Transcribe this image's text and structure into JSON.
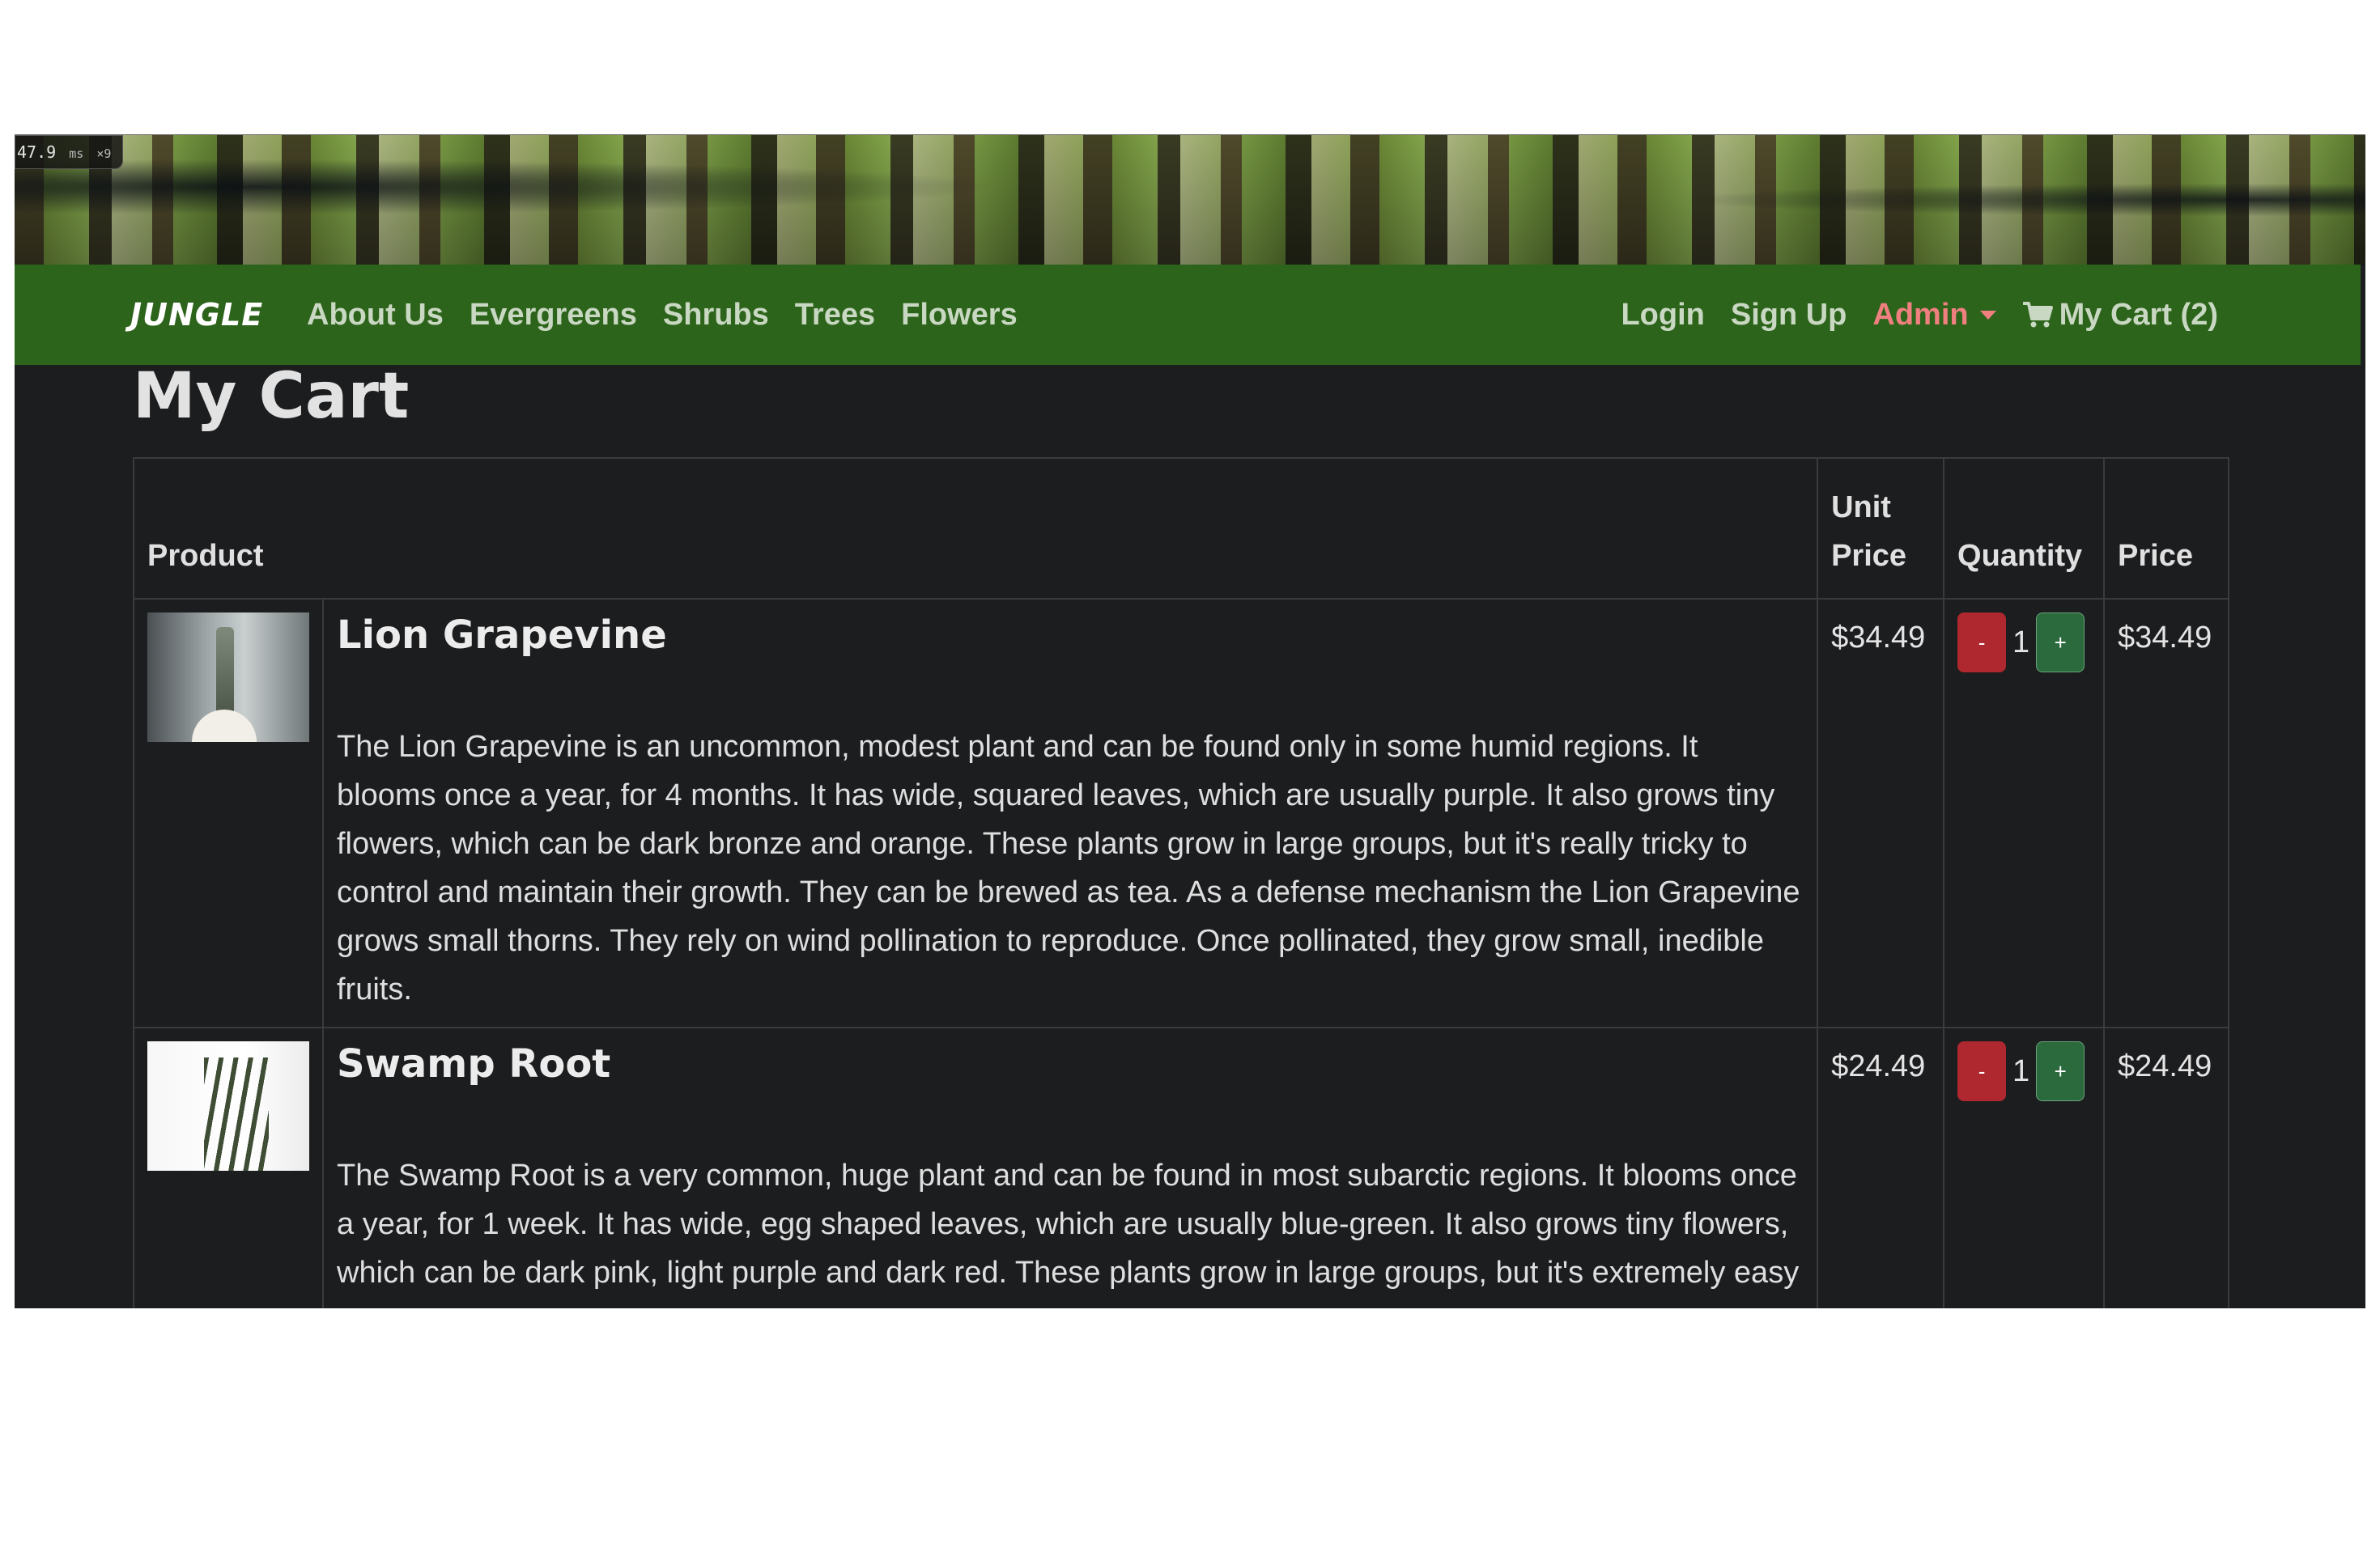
{
  "perf": {
    "value": "47.9",
    "unit": "ms",
    "multiplier": "×9"
  },
  "nav": {
    "brand": "JUNGLE",
    "left_links": [
      "About Us",
      "Evergreens",
      "Shrubs",
      "Trees",
      "Flowers"
    ],
    "login": "Login",
    "signup": "Sign Up",
    "admin": "Admin",
    "cart": "My Cart (2)",
    "colors": {
      "bar": "#2d641b",
      "admin": "#f08080"
    }
  },
  "page": {
    "title": "My Cart"
  },
  "table": {
    "headers": {
      "product": "Product",
      "unit_price_line1": "Unit",
      "unit_price_line2": "Price",
      "quantity": "Quantity",
      "price": "Price"
    },
    "rows": [
      {
        "name": "Lion Grapevine",
        "description": "The Lion Grapevine is an uncommon, modest plant and can be found only in some humid regions. It blooms once a year, for 4 months. It has wide, squared leaves, which are usually purple. It also grows tiny flowers, which can be dark bronze and orange. These plants grow in large groups, but it's really tricky to control and maintain their growth. They can be brewed as tea. As a defense mechanism the Lion Grapevine grows small thorns. They rely on wind pollination to reproduce. Once pollinated, they grow small, inedible fruits.",
        "unit_price": "$34.49",
        "quantity": "1",
        "price": "$34.49",
        "minus_label": "-",
        "plus_label": "+"
      },
      {
        "name": "Swamp Root",
        "description": "The Swamp Root is a very common, huge plant and can be found in most subarctic regions. It blooms once a year, for 1 week. It has wide, egg shaped leaves, which are usually blue-green. It also grows tiny flowers, which can be dark pink, light purple and dark red. These plants grow in large groups, but it's extremely easy to control and maintain their growth. They can be used to create a poison. As a defense mechanism the",
        "unit_price": "$24.49",
        "quantity": "1",
        "price": "$24.49",
        "minus_label": "-",
        "plus_label": "+"
      }
    ]
  }
}
